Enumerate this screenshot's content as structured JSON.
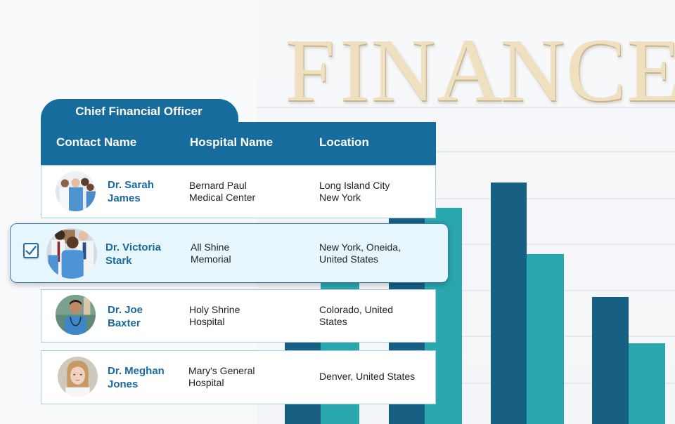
{
  "background": {
    "word": [
      "F",
      "I",
      "N",
      "A",
      "N",
      "C",
      "E"
    ],
    "colors": {
      "bar_dark": "#175f83",
      "bar_teal": "#2aa6ad",
      "letters": "#efe0c0"
    },
    "bars": [
      {
        "series": "dark",
        "value": 0.22
      },
      {
        "series": "teal",
        "value": 0.4
      },
      {
        "series": "dark",
        "value": 0.58
      },
      {
        "series": "teal",
        "value": 0.51
      },
      {
        "series": "dark",
        "value": 0.57
      },
      {
        "series": "teal",
        "value": 0.4
      },
      {
        "series": "dark",
        "value": 0.3
      },
      {
        "series": "teal",
        "value": 0.19
      }
    ]
  },
  "table": {
    "tab_label": "Chief Financial Officer",
    "columns": [
      "Contact Name",
      "Hospital Name",
      "Location"
    ],
    "colors": {
      "header": "#176c9e",
      "name_text": "#1a6aa0",
      "selected_row": "#e7f5fd"
    },
    "rows": [
      {
        "name_line1": "Dr. Sarah",
        "name_line2": "James",
        "hospital_line1": "Bernard Paul",
        "hospital_line2": "Medical Center",
        "location_line1": "Long Island City",
        "location_line2": "New York",
        "avatar": "group-of-doctors-photo",
        "selected": false
      },
      {
        "name_line1": "Dr. Victoria",
        "name_line2": "Stark",
        "hospital_line1": "All Shine",
        "hospital_line2": "Memorial",
        "location_line1": "New York, Oneida,",
        "location_line2": "United States",
        "avatar": "nurse-with-doctors-photo",
        "selected": true
      },
      {
        "name_line1": "Dr. Joe",
        "name_line2": "Baxter",
        "hospital_line1": "Holy Shrine",
        "hospital_line2": "Hospital",
        "location_line1": "Colorado, United",
        "location_line2": "States",
        "avatar": "male-doctor-stethoscope-photo",
        "selected": false
      },
      {
        "name_line1": "Dr. Meghan",
        "name_line2": "Jones",
        "hospital_line1": "Mary's General",
        "hospital_line2": "Hospital",
        "location_line1": "Denver, United States",
        "location_line2": "",
        "avatar": "female-doctor-portrait-photo",
        "selected": false
      }
    ]
  }
}
